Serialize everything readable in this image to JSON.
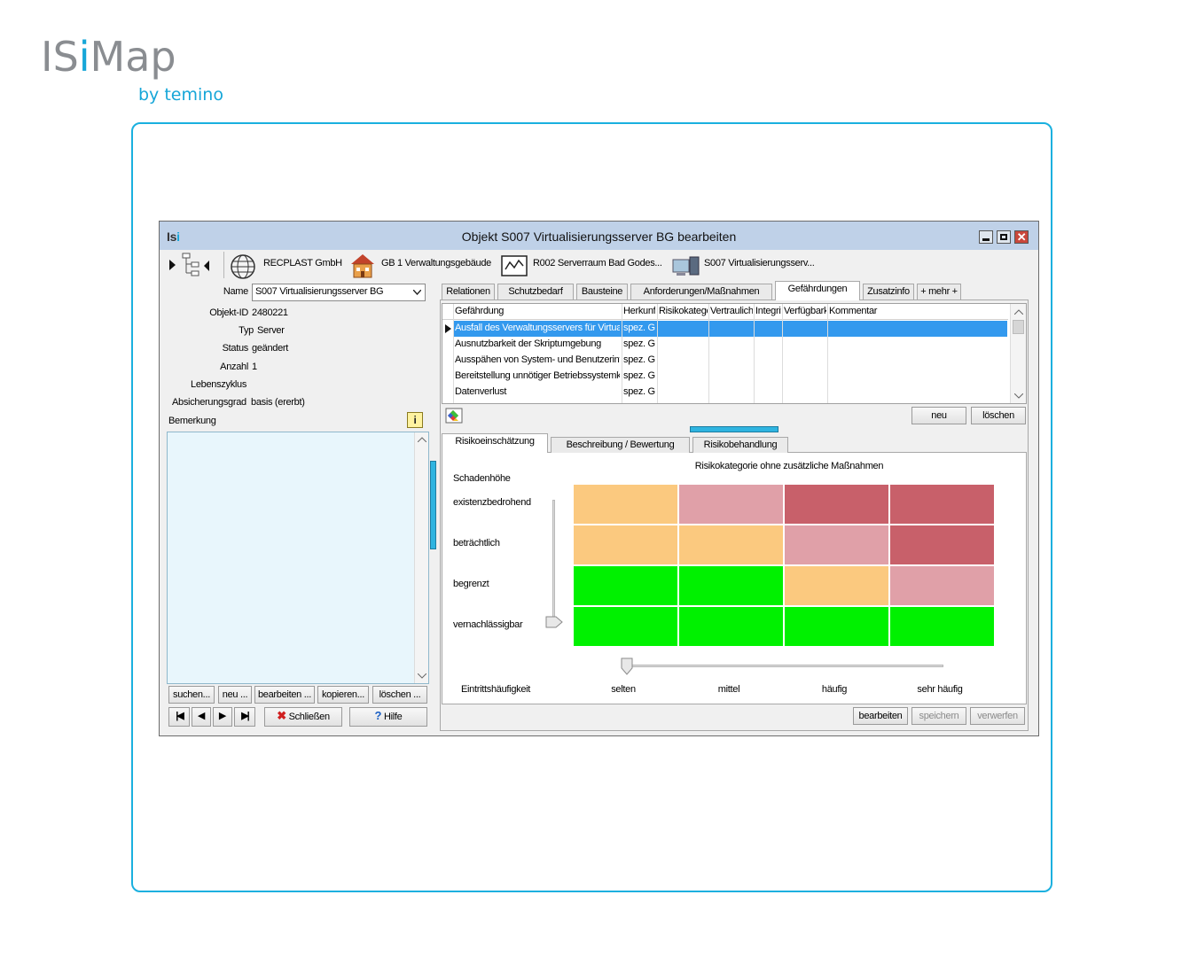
{
  "brand": {
    "name_prefix": "IS",
    "name_i": "i",
    "name_suffix": "Map",
    "subtitle": "by temino"
  },
  "window": {
    "logo_a": "Is",
    "logo_b": "i",
    "title": "Objekt S007 Virtualisierungsserver BG bearbeiten",
    "close_glyph": "✕"
  },
  "breadcrumb": [
    {
      "label": "RECPLAST GmbH",
      "icon": "globe-icon"
    },
    {
      "label": "GB 1 Verwaltungsgebäude",
      "icon": "building-icon"
    },
    {
      "label": "R002 Serverraum Bad Godes...",
      "icon": "room-icon"
    },
    {
      "label": "S007 Virtualisierungsserv...",
      "icon": "server-icon"
    }
  ],
  "form": {
    "name_label": "Name",
    "name_value": "S007 Virtualisierungsserver BG",
    "objekt_id_label": "Objekt-ID",
    "objekt_id_value": "2480221",
    "typ_label": "Typ",
    "typ_value": "Server",
    "status_label": "Status",
    "status_value": "geändert",
    "anzahl_label": "Anzahl",
    "anzahl_value": "1",
    "lebenszyklus_label": "Lebenszyklus",
    "absicherung_label": "Absicherungsgrad",
    "absicherung_value": "basis (ererbt)",
    "bemerkung_label": "Bemerkung",
    "info_glyph": "i"
  },
  "left_buttons": [
    "suchen...",
    "neu ...",
    "bearbeiten ...",
    "kopieren...",
    "löschen ..."
  ],
  "nav": {
    "first": "|◀",
    "prev": "◀",
    "next": "▶",
    "last": "▶|",
    "close_label": "Schließen",
    "help_label": "Hilfe",
    "close_glyph": "✖",
    "help_glyph": "?"
  },
  "tabs": [
    "Relationen",
    "Schutzbedarf",
    "Bausteine",
    "Anforderungen/Maßnahmen",
    "Gefährdungen",
    "Zusatzinfo",
    "+ mehr +"
  ],
  "active_tab": "Gefährdungen",
  "grid": {
    "columns": [
      "Gefährdung",
      "Herkunft",
      "Risikokategorie",
      "Vertraulich",
      "Integrität",
      "Verfügbarkeit",
      "Kommentar"
    ],
    "rows": [
      [
        "Ausfall des Verwaltungsservers für Virtualisierung",
        "spez. G",
        "",
        "",
        "",
        "",
        ""
      ],
      [
        "Ausnutzbarkeit der Skriptumgebung",
        "spez. G",
        "",
        "",
        "",
        "",
        ""
      ],
      [
        "Ausspähen von System- und Benutzerinformationen",
        "spez. G",
        "",
        "",
        "",
        "",
        ""
      ],
      [
        "Bereitstellung unnötiger Betriebssystemkomponenten",
        "spez. G",
        "",
        "",
        "",
        "",
        ""
      ],
      [
        "Datenverlust",
        "spez. G",
        "",
        "",
        "",
        "",
        ""
      ]
    ],
    "selected_row": 0
  },
  "grid_buttons": {
    "new": "neu",
    "delete": "löschen"
  },
  "subtabs": [
    "Risikoeinschätzung",
    "Beschreibung / Bewertung",
    "Risikobehandlung"
  ],
  "active_subtab": "Risikoeinschätzung",
  "risk": {
    "title": "Risikokategorie ohne zusätzliche Maßnahmen",
    "y_title": "Schadenhöhe",
    "x_title": "Eintrittshäufigkeit",
    "rows": [
      "existenzbedrohend",
      "beträchtlich",
      "begrenzt",
      "vernachlässigbar"
    ],
    "cols": [
      "selten",
      "mittel",
      "häufig",
      "sehr häufig"
    ],
    "cells": [
      [
        "mittel",
        "hoch",
        "sehr hoch",
        "sehr hoch"
      ],
      [
        "mittel",
        "mittel",
        "hoch",
        "sehr hoch"
      ],
      [
        "gering",
        "gering",
        "mittel",
        "hoch"
      ],
      [
        "gering",
        "gering",
        "gering",
        "gering"
      ]
    ],
    "colors": {
      "gering": "#00f100",
      "mittel": "#fbc97f",
      "hoch": "#e0a0a8",
      "sehr hoch": "#c8606a"
    },
    "selected_row": "vernachlässigbar",
    "selected_col": "selten"
  },
  "bottom_buttons": {
    "edit": "bearbeiten",
    "save": "speichern",
    "discard": "verwerfen"
  }
}
